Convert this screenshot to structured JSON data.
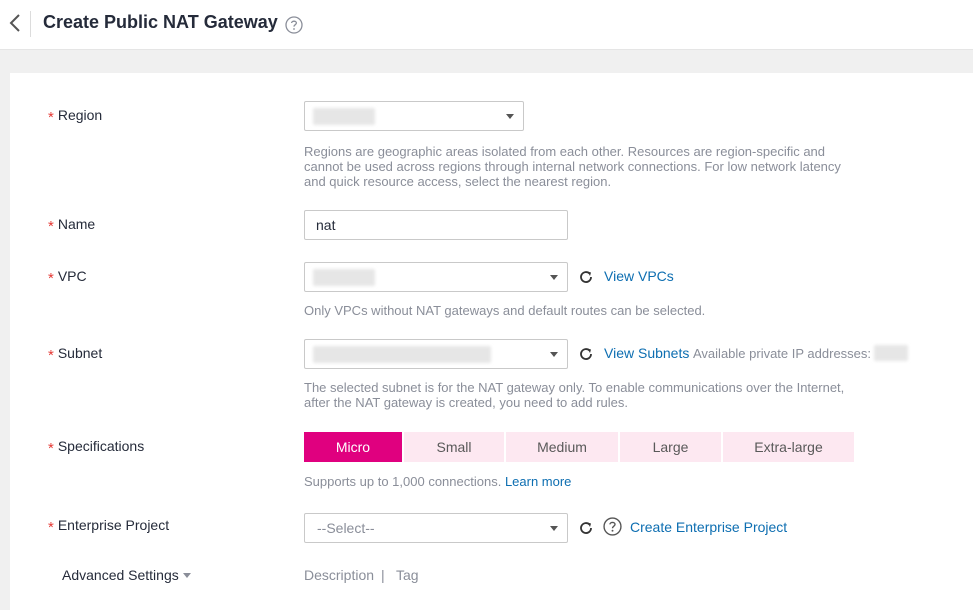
{
  "header": {
    "title": "Create Public NAT Gateway"
  },
  "form": {
    "region": {
      "label": "Region",
      "hint": "Regions are geographic areas isolated from each other. Resources are region-specific and cannot be used across regions through internal network connections. For low network latency and quick resource access, select the nearest region."
    },
    "name": {
      "label": "Name",
      "value": "nat"
    },
    "vpc": {
      "label": "VPC",
      "link": "View VPCs",
      "hint": "Only VPCs without NAT gateways and default routes can be selected."
    },
    "subnet": {
      "label": "Subnet",
      "link": "View Subnets",
      "available_label": "Available private IP addresses:",
      "hint": "The selected subnet is for the NAT gateway only. To enable communications over the Internet, after the NAT gateway is created, you need to add rules."
    },
    "specifications": {
      "label": "Specifications",
      "options": [
        "Micro",
        "Small",
        "Medium",
        "Large",
        "Extra-large"
      ],
      "selected": "Micro",
      "hint": "Supports up to 1,000 connections.",
      "learn_more": "Learn more"
    },
    "enterprise_project": {
      "label": "Enterprise Project",
      "placeholder": "--Select--",
      "link": "Create Enterprise Project"
    },
    "advanced": {
      "label": "Advanced Settings",
      "summary_description": "Description",
      "summary_separator": "|",
      "summary_tag": "Tag"
    }
  },
  "colors": {
    "accent": "#e0007f",
    "accent_light": "#fde8f1",
    "link": "#0d6eb1",
    "required": "#e53935"
  }
}
